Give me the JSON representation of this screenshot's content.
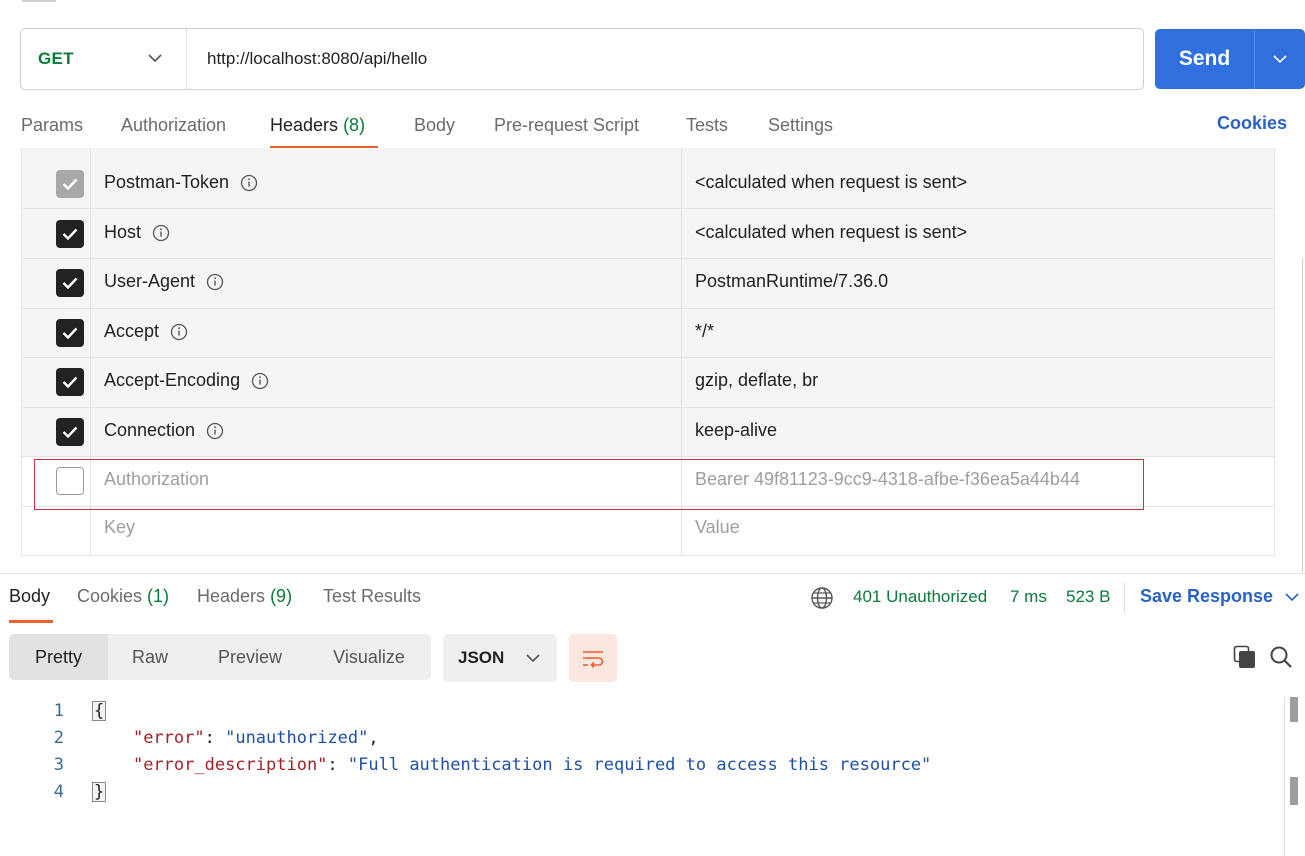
{
  "request": {
    "method": "GET",
    "url": "http://localhost:8080/api/hello",
    "send_label": "Send"
  },
  "request_tabs": {
    "params": "Params",
    "authorization": "Authorization",
    "headers_label": "Headers",
    "headers_count": "(8)",
    "body": "Body",
    "pre_request": "Pre-request Script",
    "tests": "Tests",
    "settings": "Settings",
    "cookies": "Cookies"
  },
  "headers": [
    {
      "key": "Postman-Token",
      "value": "<calculated when request is sent>",
      "state": "checked-disabled"
    },
    {
      "key": "Host",
      "value": "<calculated when request is sent>",
      "state": "checked"
    },
    {
      "key": "User-Agent",
      "value": "PostmanRuntime/7.36.0",
      "state": "checked"
    },
    {
      "key": "Accept",
      "value": "*/*",
      "state": "checked"
    },
    {
      "key": "Accept-Encoding",
      "value": "gzip, deflate, br",
      "state": "checked"
    },
    {
      "key": "Connection",
      "value": "keep-alive",
      "state": "checked"
    },
    {
      "key": "Authorization",
      "value": "Bearer 49f81123-9cc9-4318-afbe-f36ea5a44b44",
      "state": "unchecked"
    }
  ],
  "new_header": {
    "key_placeholder": "Key",
    "value_placeholder": "Value"
  },
  "response_tabs": {
    "body": "Body",
    "cookies_label": "Cookies",
    "cookies_count": "(1)",
    "headers_label": "Headers",
    "headers_count": "(9)",
    "test_results": "Test Results"
  },
  "response_status": {
    "status": "401 Unauthorized",
    "time": "7 ms",
    "size": "523 B",
    "save_label": "Save Response"
  },
  "view_modes": {
    "pretty": "Pretty",
    "raw": "Raw",
    "preview": "Preview",
    "visualize": "Visualize"
  },
  "format": "JSON",
  "code": {
    "line_numbers": [
      "1",
      "2",
      "3",
      "4"
    ],
    "open_brace": "{",
    "close_brace": "}",
    "key1": "\"error\"",
    "val1": "\"unauthorized\"",
    "key2": "\"error_description\"",
    "val2": "\"Full authentication is required to access this resource\""
  },
  "colors": {
    "accent": "#e8602c",
    "send": "#2f6fde",
    "success_text": "#0b7a3a",
    "link": "#2a62c9",
    "highlight": "#c9343c"
  }
}
